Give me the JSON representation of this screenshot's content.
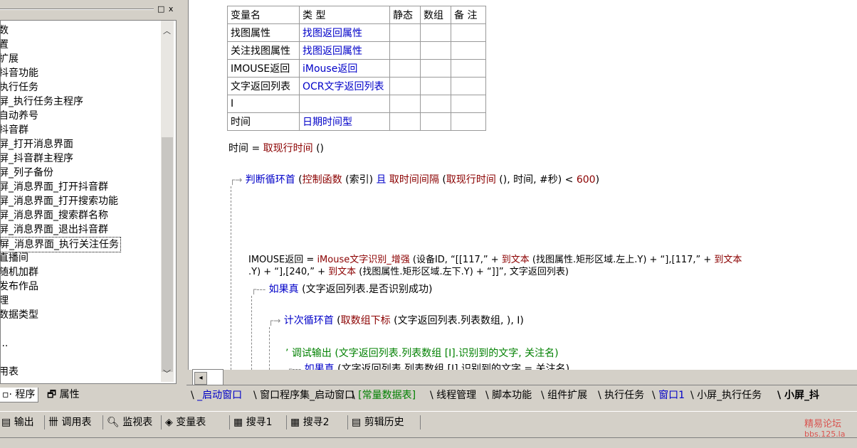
{
  "left_panel": {
    "title_buttons": "□ x",
    "tree_items": [
      "数",
      "置",
      "扩展",
      "抖音功能",
      "执行任务",
      "屏_执行任务主程序",
      "自动养号",
      "抖音群",
      "屏_打开消息界面",
      "屏_抖音群主程序",
      "屏_列子备份",
      "屏_消息界面_打开抖音群",
      "屏_消息界面_打开搜索功能",
      "屏_消息界面_搜索群名称",
      "屏_消息界面_退出抖音群",
      "屏_消息界面_执行关注任务",
      "直播间",
      "随机加群",
      "发布作品",
      "理",
      "数据类型",
      "",
      "...",
      "",
      "用表"
    ],
    "selected_index": 15,
    "tabs": [
      "程序",
      "属性"
    ],
    "active_tab": "程序"
  },
  "var_table": {
    "headers": [
      "变量名",
      "类 型",
      "静态",
      "数组",
      "备 注"
    ],
    "rows": [
      [
        "找图属性",
        "找图返回属性",
        "",
        "",
        ""
      ],
      [
        "关注找图属性",
        "找图返回属性",
        "",
        "",
        ""
      ],
      [
        "IMOUSE返回",
        "iMouse返回",
        "",
        "",
        ""
      ],
      [
        "文字返回列表",
        "OCR文字返回列表",
        "",
        "",
        ""
      ],
      [
        "I",
        "",
        "",
        "",
        ""
      ],
      [
        "时间",
        "日期时间型",
        "",
        "",
        ""
      ]
    ]
  },
  "code": {
    "line1": {
      "a": "时间",
      "b": " = ",
      "c": "取现行时间",
      "d": " ()"
    },
    "line2": {
      "a": "判断循环首",
      "b": " (",
      "c": "控制函数",
      "d": " (索引) ",
      "e": "且",
      "f": " 取时间间隔",
      "g": " (",
      "h": "取现行时间",
      "i": " (), 时间, #秒) < ",
      "j": "600",
      "k": ")"
    },
    "line3": {
      "a": "IMOUSE返回",
      "b": " = ",
      "c": "iMouse文字识别_增强",
      "d": " (设备ID, “[[117,” + ",
      "e": "到文本",
      "f": " (找图属性.矩形区域.左上.Y) + “],[117,” + ",
      "g": "到文本"
    },
    "line3b": {
      "a": ".Y) + “],[240,” + ",
      "b": "到文本",
      "c": " (找图属性.矩形区域.左下.Y) + “]]”, 文字返回列表)"
    },
    "line4": {
      "a": "如果真",
      "b": " (文字返回列表.是否识别成功)"
    },
    "line5": {
      "a": "计次循环首",
      "b": " (",
      "c": "取数组下标",
      "d": " (文字返回列表.列表数组, ), I)"
    },
    "line6": {
      "a": "’ 调试输出 (文字返回列表.列表数组 [I].识别到的文字, 关注名)"
    },
    "line7": {
      "a": "如果真",
      "b": " (文字返回列表.列表数组 [I].识别到的文字 = 关注名)"
    }
  },
  "editor_tabs": [
    {
      "label": "_启动窗口",
      "style": "lk"
    },
    {
      "label": "窗口程序集_启动窗口",
      "style": ""
    },
    {
      "label": "[常量数据表]",
      "style": "gr"
    },
    {
      "label": "线程管理",
      "style": ""
    },
    {
      "label": "脚本功能",
      "style": ""
    },
    {
      "label": "组件扩展",
      "style": ""
    },
    {
      "label": "执行任务",
      "style": ""
    },
    {
      "label": "窗口1",
      "style": "lk"
    },
    {
      "label": "小屏_执行任务",
      "style": ""
    },
    {
      "label": "小屏_抖",
      "style": "bold"
    }
  ],
  "bottom_toolbar": [
    {
      "icon": "output-icon",
      "label": "输出"
    },
    {
      "icon": "call-table-icon",
      "label": "调用表"
    },
    {
      "icon": "monitor-icon",
      "label": "监视表"
    },
    {
      "icon": "variable-icon",
      "label": "变量表"
    },
    {
      "icon": "search1-icon",
      "label": "搜寻1"
    },
    {
      "icon": "search2-icon",
      "label": "搜寻2"
    },
    {
      "icon": "clipboard-icon",
      "label": "剪辑历史"
    }
  ],
  "watermark": {
    "line1": "精易论坛",
    "line2": "bbs.125.la"
  },
  "colors": {
    "keyword": "#0000c8",
    "function": "#8b0000",
    "comment": "#008000",
    "watermark": "#d9534f"
  }
}
